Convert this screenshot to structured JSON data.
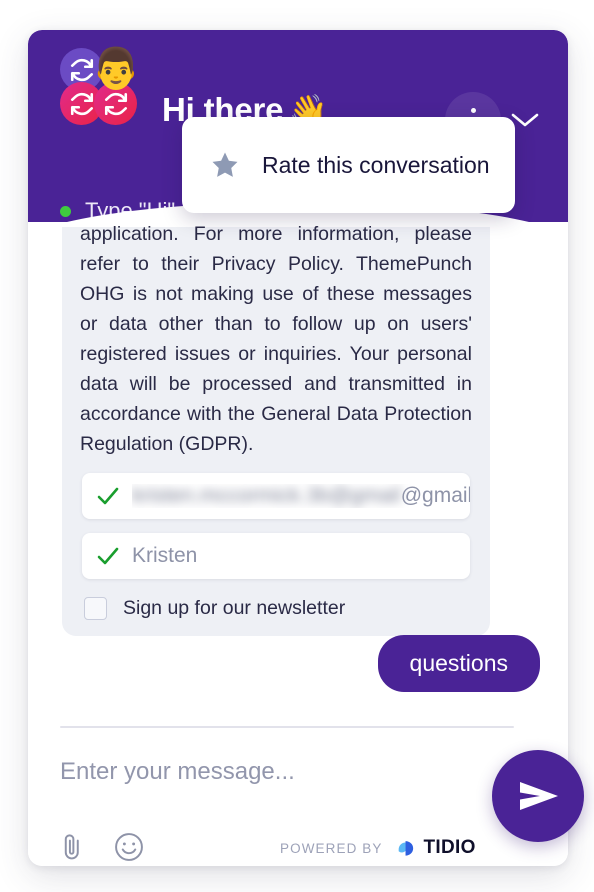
{
  "theme": {
    "brand_purple": "#4A2396",
    "accent_pink": "#E02B8C",
    "panel_gray": "#EEF0F5",
    "status_green": "#3FCB3F",
    "check_green": "#1A9E2E",
    "tidio_blue": "#2E8BF0"
  },
  "header": {
    "title": "Hi there",
    "title_emoji": "👋",
    "avatar_face_emoji": "👨",
    "avatars": [
      {
        "name": "avatar-sync-purple",
        "icon": "sync-icon"
      },
      {
        "name": "avatar-sync-pink-1",
        "icon": "sync-icon"
      },
      {
        "name": "avatar-sync-pink-2",
        "icon": "sync-icon"
      }
    ],
    "status_text": "Type \"Hi\"",
    "menu_icon": "more-vertical-icon",
    "collapse_icon": "chevron-down-icon"
  },
  "dropdown": {
    "visible": true,
    "items": [
      {
        "label": "Rate this conversation",
        "icon": "star-icon"
      }
    ]
  },
  "conversation": {
    "bot_message": "application. For more information, please refer to their Privacy Policy. ThemePunch OHG is not making use of these messages or data other than to follow up on users' registered issues or inquiries. Your personal data will be processed and transmitted in accordance with the General Data Protection Regulation (GDPR).",
    "fields": [
      {
        "name": "email-field",
        "icon": "check-icon",
        "redacted_value": "kristen.mccormick.3b@gmail",
        "visible_value": "@gmail.co",
        "is_redacted": true
      },
      {
        "name": "name-field",
        "icon": "check-icon",
        "value": "Kristen",
        "is_redacted": false
      }
    ],
    "newsletter": {
      "label": "Sign up for our newsletter",
      "checked": false
    },
    "user_message": "questions"
  },
  "composer": {
    "placeholder": "Enter your message...",
    "attach_icon": "paperclip-icon",
    "emoji_icon": "smiley-icon",
    "send_icon": "send-icon",
    "powered_by_label": "POWERED BY",
    "brand_name": "TIDIO"
  }
}
